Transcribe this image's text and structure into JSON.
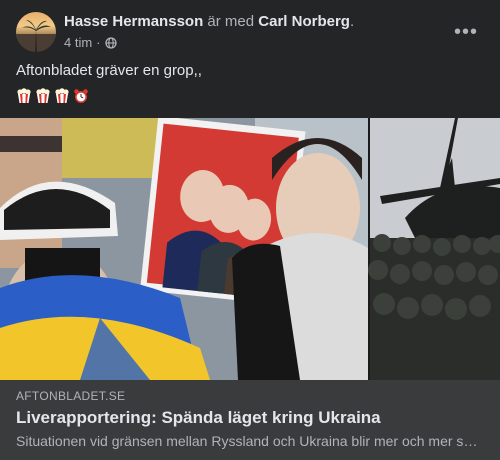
{
  "post": {
    "author": "Hasse Hermansson",
    "with_text": "är med",
    "tagged": "Carl Norberg",
    "tagged_suffix": ".",
    "time": "4 tim",
    "separator": "·",
    "audience_icon": "globe-icon",
    "more_icon": "more-horizontal-icon",
    "more_label": "•••",
    "text": "Aftonbladet gräver en grop,,",
    "emojis": [
      "popcorn",
      "popcorn",
      "popcorn",
      "alarm-clock"
    ]
  },
  "link": {
    "domain": "AFTONBLADET.SE",
    "title": "Liverapportering: Spända läget kring Ukraina",
    "description": "Situationen vid gränsen mellan Ryssland och Ukraina blir mer och mer spänd. Ryssland har samlat trupper nära gränsen."
  },
  "colors": {
    "background": "#242526",
    "card": "#3a3b3c",
    "primary_text": "#e4e6eb",
    "secondary_text": "#b0b3b8",
    "ukraine_blue": "#2b5fc7",
    "ukraine_yellow": "#f2c62b",
    "poster_red": "#d33a33"
  }
}
